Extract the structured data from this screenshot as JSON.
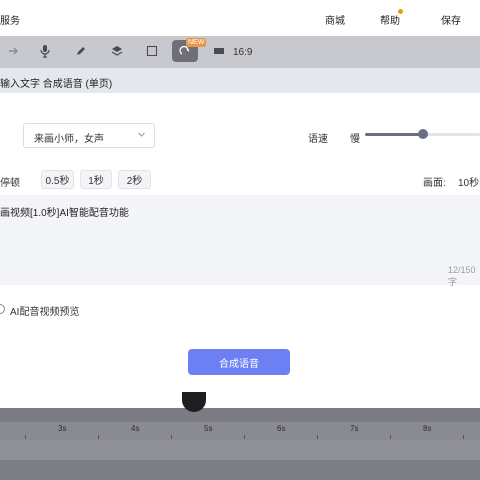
{
  "topbar": {
    "title_fragment": "服务",
    "nav": [
      "商城",
      "帮助",
      "保存"
    ]
  },
  "toolbar": {
    "new_badge": "NEW",
    "ratio": "16:9"
  },
  "dialog": {
    "header": "输入文字 合成语音 (单页)",
    "voice_value": "来画小师，女声",
    "speed_label": "语速",
    "slow_label": "慢",
    "speed_level": 0.5,
    "pause_label": "停顿",
    "pause_options": [
      "0.5秒",
      "1秒",
      "2秒"
    ],
    "canvas_label": "画面:",
    "canvas_value": "10秒",
    "text_content": "画视频[1.0秒]AI智能配音功能",
    "char_count": "12/150字",
    "preview_label": "AI配音视频预览",
    "synth_button": "合成语音"
  },
  "timeline": {
    "ticks": [
      "3s",
      "4s",
      "5s",
      "6s",
      "7s",
      "8s"
    ]
  },
  "colors": {
    "accent": "#6c80f4",
    "slider": "#6b6e82",
    "badge": "#e8964a"
  }
}
